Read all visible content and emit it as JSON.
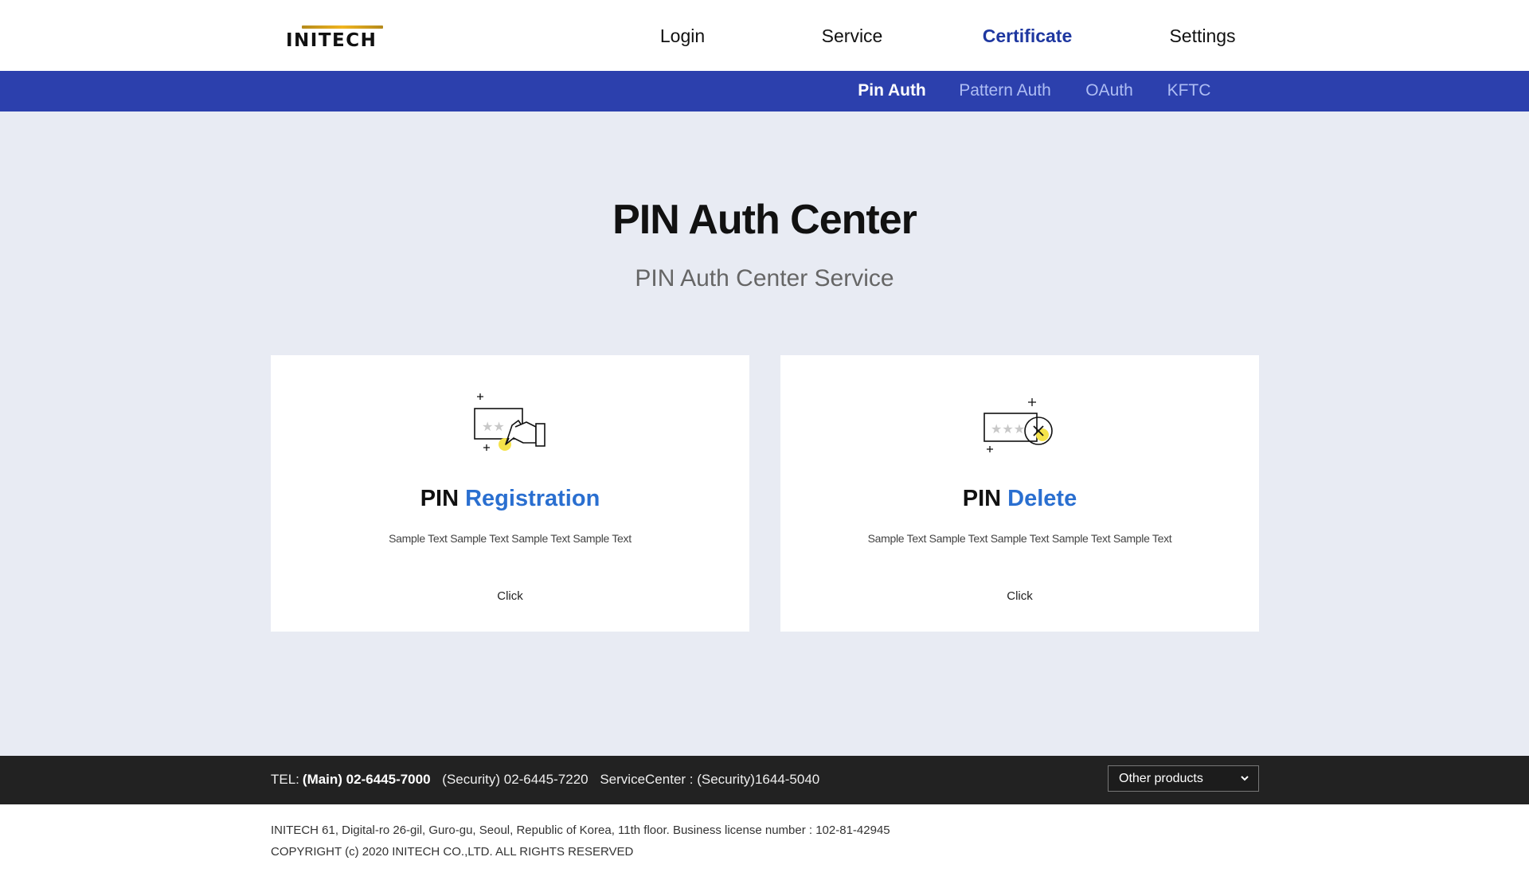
{
  "header": {
    "logo_text": "INITECH",
    "nav": [
      {
        "label": "Login"
      },
      {
        "label": "Service"
      },
      {
        "label": "Certificate",
        "active": true
      },
      {
        "label": "Settings"
      }
    ]
  },
  "subnav": {
    "items": [
      {
        "label": "Pin Auth",
        "active": true
      },
      {
        "label": "Pattern Auth"
      },
      {
        "label": "OAuth"
      },
      {
        "label": "KFTC"
      }
    ]
  },
  "hero": {
    "title": "PIN Auth Center",
    "subtitle": "PIN Auth Center Service"
  },
  "cards": [
    {
      "icon": "pin-registration-icon",
      "title_prefix": "PIN",
      "title_accent": "Registration",
      "description": "Sample Text Sample Text Sample Text Sample Text",
      "action": "Click"
    },
    {
      "icon": "pin-delete-icon",
      "title_prefix": "PIN",
      "title_accent": "Delete",
      "description": "Sample Text Sample Text Sample Text Sample Text Sample Text",
      "action": "Click"
    }
  ],
  "footer": {
    "tel_label": "TEL:",
    "tel_main": "(Main) 02-6445-7000",
    "tel_security": "(Security) 02-6445-7220",
    "service_center": "ServiceCenter : (Security)1644-5040",
    "other_products": "Other products",
    "address": "INITECH 61, Digital-ro 26-gil, Guro-gu, Seoul, Republic of Korea, 11th floor. Business license number : 102-81-42945",
    "copyright": "COPYRIGHT (c) 2020 INITECH CO.,LTD. ALL RIGHTS RESERVED"
  },
  "colors": {
    "accent": "#2c40ad",
    "active_nav": "#1e37a0",
    "title_accent": "#2a6fd0",
    "highlight": "#f5e34a",
    "footer_bg": "#222222",
    "page_bg": "#e8ebf3"
  }
}
